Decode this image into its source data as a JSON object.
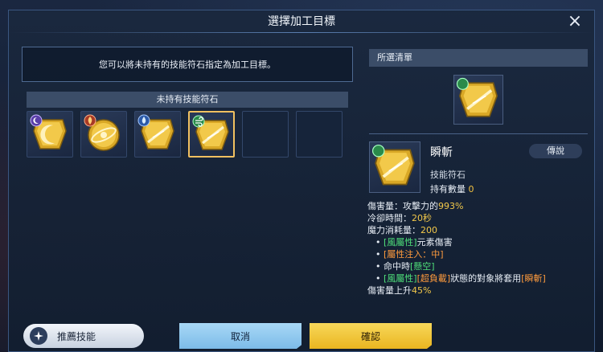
{
  "dialog": {
    "title": "選擇加工目標",
    "close_icon": "×"
  },
  "left": {
    "info_text": "您可以將未持有的技能符石指定為加工目標。",
    "section_title": "未持有技能符石",
    "slots": [
      {
        "filled": true,
        "selected": false,
        "element": "dark",
        "glyph": "moon-slash"
      },
      {
        "filled": true,
        "selected": false,
        "element": "fire",
        "glyph": "orbit"
      },
      {
        "filled": true,
        "selected": false,
        "element": "water",
        "glyph": "slash"
      },
      {
        "filled": true,
        "selected": true,
        "element": "wind",
        "glyph": "slash"
      },
      {
        "filled": false,
        "selected": false
      },
      {
        "filled": false,
        "selected": false
      }
    ]
  },
  "right": {
    "list_title": "所選清單",
    "skill": {
      "name": "瞬斬",
      "tag": "傳說",
      "type": "技能符石",
      "owned_label": "持有數量",
      "owned_count": "0"
    },
    "desc": {
      "dmg_label": "傷害量：攻擊力的",
      "dmg_value": "993%",
      "cd_label": "冷卻時間：",
      "cd_value": "20秒",
      "mp_label": "魔力消耗量：",
      "mp_value": "200",
      "b1_tag": "[風屬性]",
      "b1_text": "元素傷害",
      "b2_tag": "[屬性注入：中]",
      "b3_text": "命中時",
      "b3_tag": "[懸空]",
      "b4_tag1": "[風屬性]",
      "b4_tag2": "[超負載]",
      "b4_text": "狀態的對象將套用",
      "b4_tag3": "[瞬斬]",
      "last": "傷害量上升",
      "last_value": "45%"
    }
  },
  "buttons": {
    "recommend": "推薦技能",
    "cancel": "取消",
    "confirm": "確認"
  },
  "colors": {
    "accent_gold": "#f0c060",
    "cancel_blue": "#7cbbe8",
    "confirm_yellow": "#e9b520"
  }
}
